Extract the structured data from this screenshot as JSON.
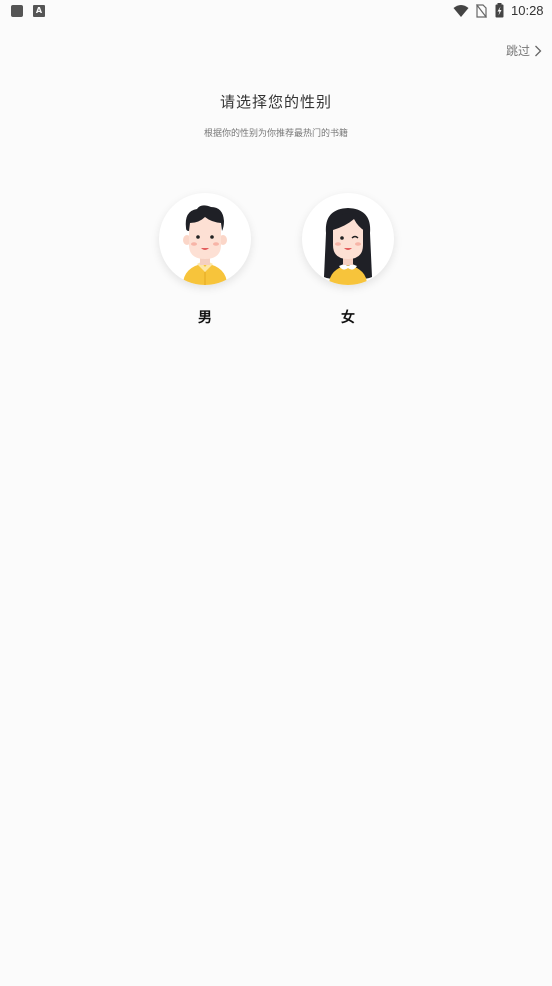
{
  "status_bar": {
    "time": "10:28",
    "left_icons": [
      "app-notification-icon",
      "keyboard-a-icon"
    ],
    "keyboard_icon_letter": "A",
    "right_icons": [
      "wifi-icon",
      "no-sim-icon",
      "battery-charging-icon"
    ]
  },
  "skip": {
    "label": "跳过"
  },
  "header": {
    "title": "请选择您的性别",
    "subtitle": "根据你的性别为你推荐最热门的书籍"
  },
  "options": {
    "male": {
      "label": "男",
      "icon": "male-avatar-icon"
    },
    "female": {
      "label": "女",
      "icon": "female-avatar-icon"
    }
  },
  "colors": {
    "background": "#fbfbfb",
    "shirt_yellow": "#f7c43b",
    "skin": "#fde0d4",
    "hair": "#1f2026"
  }
}
